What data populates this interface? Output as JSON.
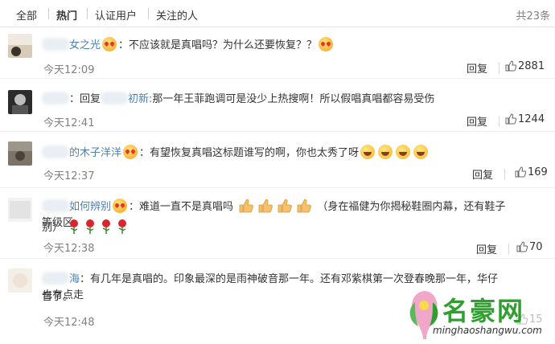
{
  "tabs": [
    {
      "label": "全部",
      "active": false
    },
    {
      "label": "热门",
      "active": true
    },
    {
      "label": "认证用户",
      "active": false
    },
    {
      "label": "关注的人",
      "active": false
    }
  ],
  "total": "共23条",
  "reply_label": "回复",
  "comments": [
    {
      "name": "女之光",
      "text": "：不应该就是真唱吗？为什么还要恢复？？",
      "time": "今天12:09",
      "likes": "2881"
    },
    {
      "name": "",
      "prefix": "：回复",
      "reply_to": "初新:",
      "text": "那一年王菲跑调可是没少上热搜啊！所以假唱真唱都容易受伤",
      "time": "今天12:41",
      "likes": "1244"
    },
    {
      "name": "的木子洋洋",
      "text": "：有望恢复真唱这标题谁写的啊，你也太秀了呀",
      "time": "今天12:37",
      "likes": "169"
    },
    {
      "name": "如何辨别",
      "text": "：难道一直不是真唱吗",
      "text2": "（身在福健为你揭秘鞋圈内幕，还有鞋子等级区",
      "text3": "别）",
      "time": "今天12:38",
      "likes": "70"
    },
    {
      "name": "海",
      "text": "：有几年是真唱的。印象最深的是雨神破音那一年。还有邓紫棋第一次登春晚那一年，华仔也有点走",
      "text2": "音了。",
      "time": "今天12:48",
      "likes": "15"
    }
  ],
  "watermark": {
    "title": "名豪网",
    "url": "minghaoshangwu.com"
  },
  "colors": {
    "link": "#4a7fb5",
    "meta": "#808080",
    "watermark": "#2f9f2f"
  }
}
